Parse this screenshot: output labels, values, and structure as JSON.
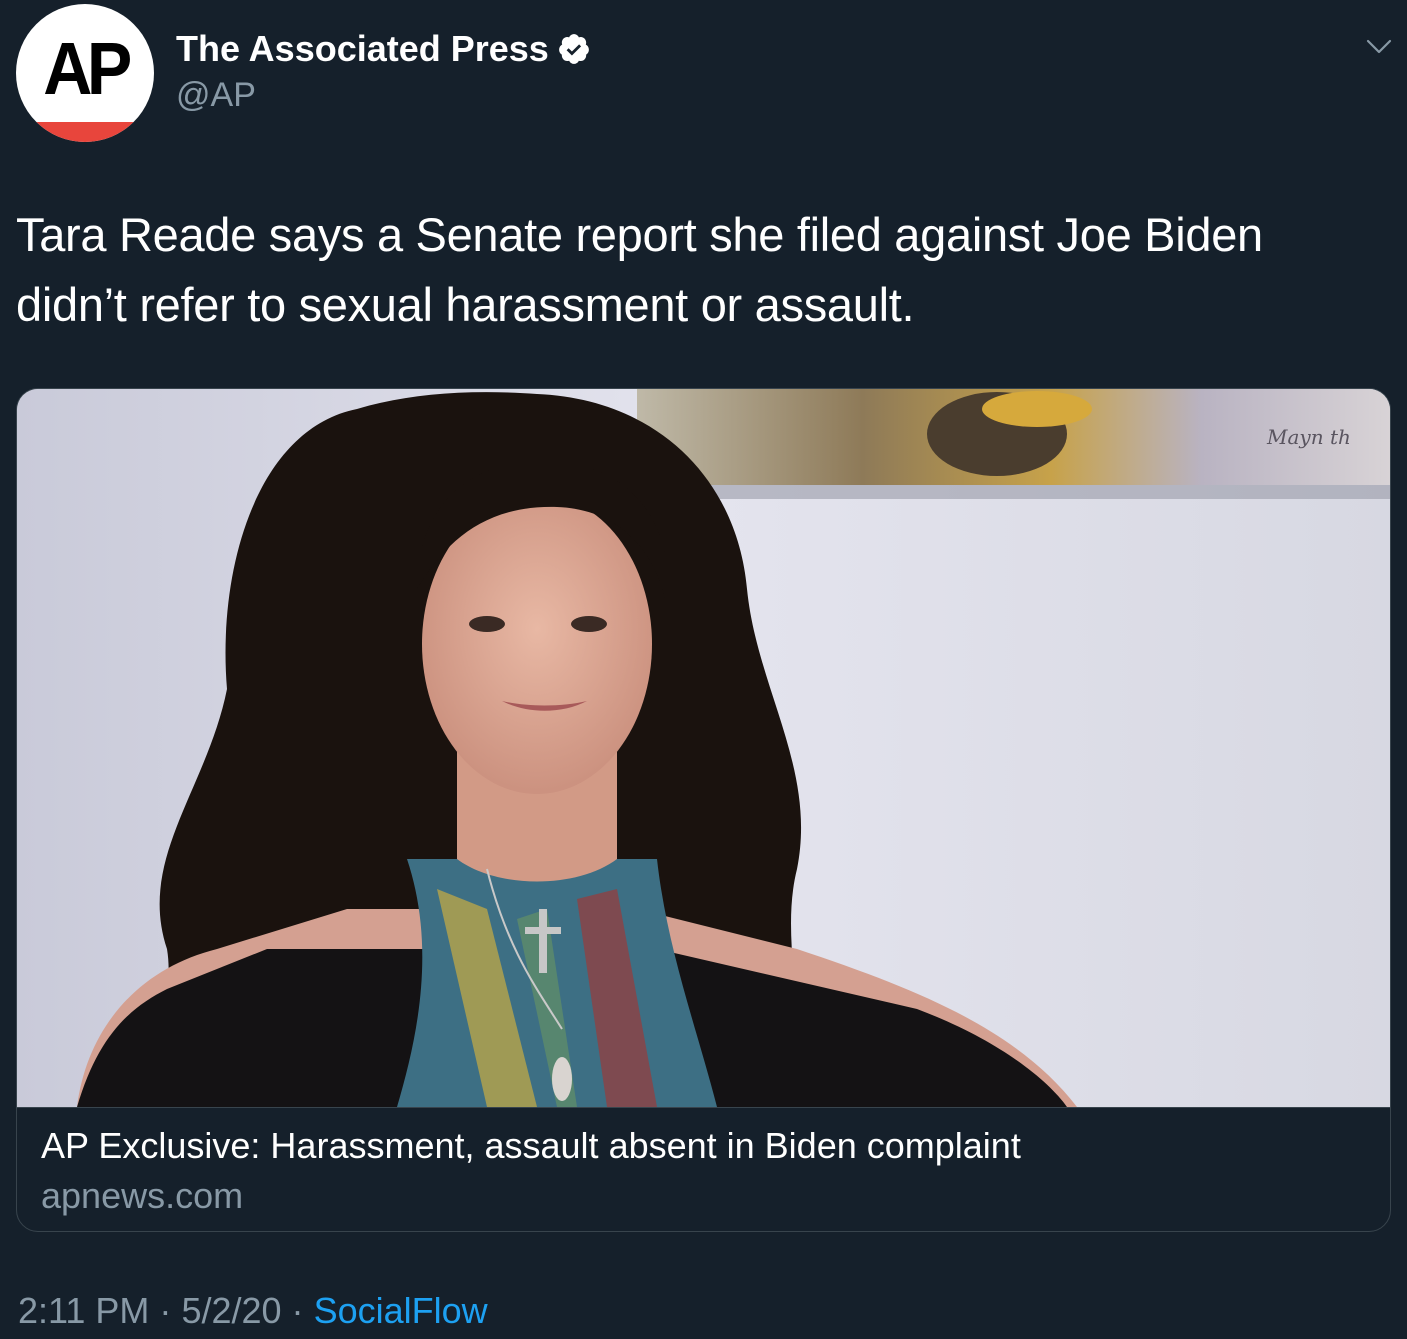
{
  "tweet": {
    "author": {
      "display_name": "The Associated Press",
      "handle": "@AP",
      "avatar_text": "AP",
      "verified": true
    },
    "text_line1": "Tara Reade says a Senate report she filed against Joe Biden",
    "text_line2": "didn’t refer to sexual harassment or assault.",
    "card": {
      "title": "AP Exclusive: Harassment, assault absent in Biden complaint",
      "domain": "apnews.com",
      "image_alt": "photo-of-woman-with-scarf"
    },
    "time": "2:11 PM",
    "separator": "·",
    "date": "5/2/20",
    "source": "SocialFlow"
  },
  "colors": {
    "background": "#15202b",
    "text_primary": "#ffffff",
    "text_secondary": "#8899a6",
    "link": "#1da1f2",
    "border": "#38444d",
    "ap_red": "#e8453c"
  },
  "icons": {
    "verified": "verified-badge-icon",
    "menu": "chevron-down-icon"
  }
}
